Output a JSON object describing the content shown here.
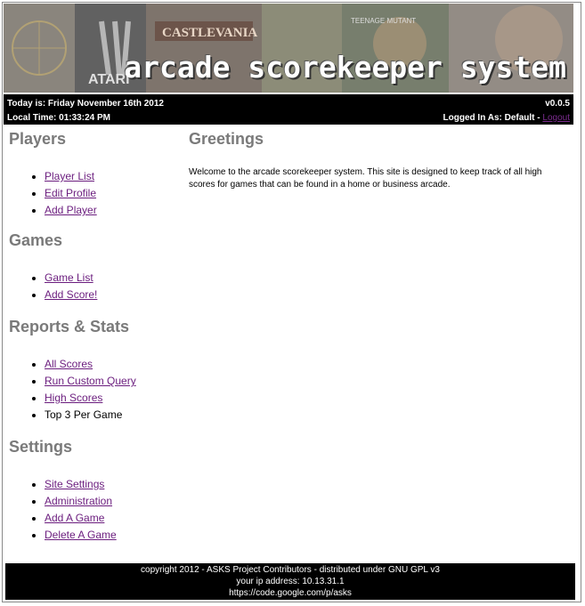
{
  "banner": {
    "title": "arcade scorekeeper system",
    "collage_labels": [
      "CASTLEVANIA",
      "ATARI",
      "TEENAGE MUTANT"
    ]
  },
  "infobar": {
    "today": "Today is: Friday November 16th 2012",
    "local_time": "Local Time: 01:33:24 PM",
    "version": "v0.0.5",
    "logged_in": "Logged In As: Default - ",
    "logout": "Logout"
  },
  "sidebar": {
    "players": {
      "heading": "Players",
      "items": [
        {
          "label": "Player List"
        },
        {
          "label": "Edit Profile"
        },
        {
          "label": "Add Player"
        }
      ]
    },
    "games": {
      "heading": "Games",
      "items": [
        {
          "label": "Game List"
        },
        {
          "label": "Add Score!"
        }
      ]
    },
    "reports": {
      "heading": "Reports & Stats",
      "items": [
        {
          "label": "All Scores"
        },
        {
          "label": "Run Custom Query"
        },
        {
          "label": "High Scores"
        },
        {
          "label": "Top 3 Per Game"
        }
      ]
    },
    "settings": {
      "heading": "Settings",
      "items": [
        {
          "label": "Site Settings"
        },
        {
          "label": "Administration"
        },
        {
          "label": "Add A Game"
        },
        {
          "label": "Delete A Game"
        }
      ]
    }
  },
  "main": {
    "heading": "Greetings",
    "body": "Welcome to the arcade scorekeeper system. This site is designed to keep track of all high scores for games that can be found in a home or business arcade."
  },
  "footer": {
    "line1": "copyright 2012 - ASKS Project Contributors - distributed under GNU GPL v3",
    "line2": "your ip address: 10.13.31.1",
    "line3": "https://code.google.com/p/asks"
  }
}
